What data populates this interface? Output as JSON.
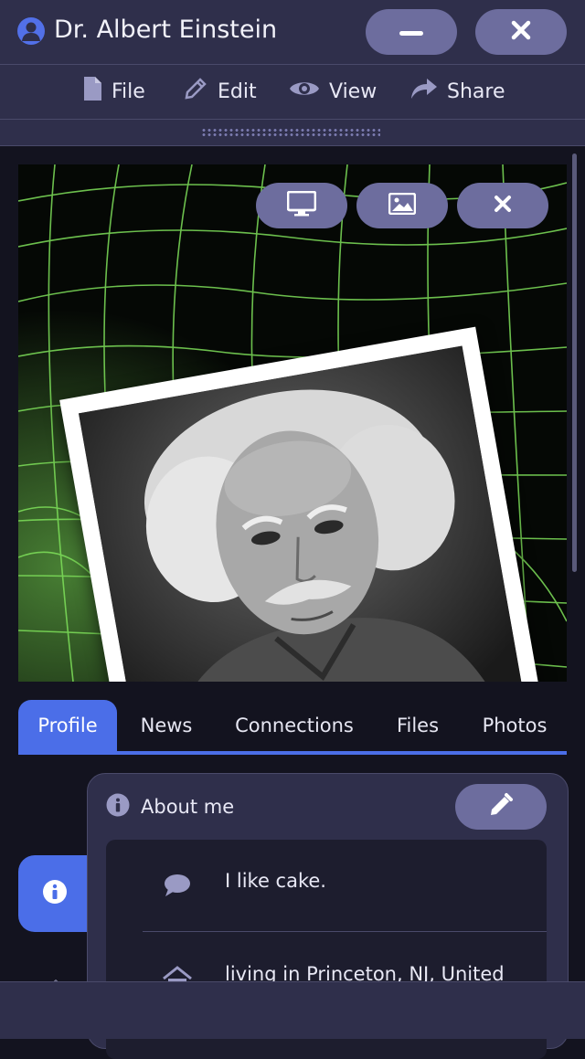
{
  "window": {
    "title": "Dr. Albert Einstein",
    "controls": [
      "minimize-icon",
      "close-icon"
    ]
  },
  "menu": {
    "items": [
      {
        "label": "File",
        "icon": "file-icon"
      },
      {
        "label": "Edit",
        "icon": "pencil-icon"
      },
      {
        "label": "View",
        "icon": "eye-icon"
      },
      {
        "label": "Share",
        "icon": "share-icon"
      }
    ]
  },
  "cover": {
    "background": "green-wireframe-grid",
    "actions": [
      "monitor-icon",
      "image-icon",
      "close-icon"
    ],
    "photo_actions": [
      "smiley-icon",
      "image-icon",
      "close-icon"
    ]
  },
  "tabs": {
    "items": [
      "Profile",
      "News",
      "Connections",
      "Files",
      "Photos"
    ],
    "active": "Profile"
  },
  "about": {
    "title": "About me",
    "edit_icon": "pencil-icon",
    "rows": [
      {
        "icon": "speech-bubble-icon",
        "text": "I like cake."
      },
      {
        "icon": "home-icon",
        "text": "living in Princeton, NJ, United"
      }
    ]
  },
  "colors": {
    "accent": "#4b6ee8",
    "pill": "#6d6d9e",
    "panel": "#2f2f4b",
    "background": "#13131f",
    "grid": "#7ee05a"
  }
}
